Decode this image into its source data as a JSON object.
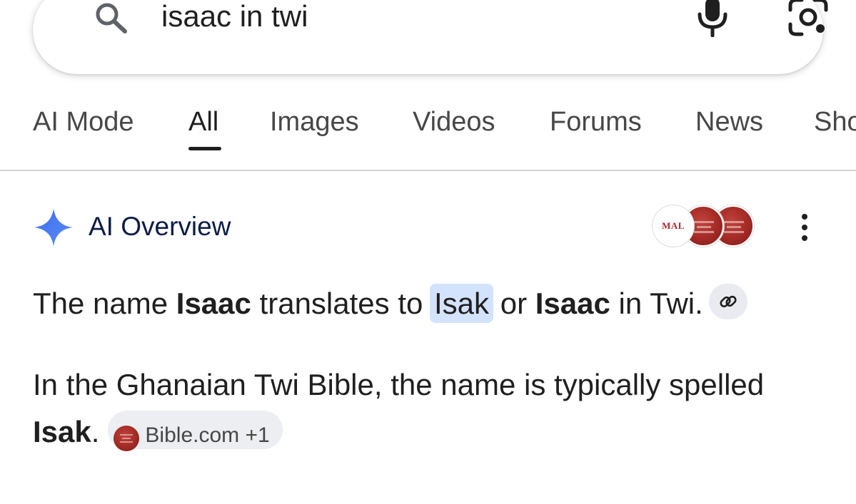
{
  "search": {
    "query": "isaac in twi"
  },
  "tabs": [
    {
      "label": "AI Mode",
      "active": false
    },
    {
      "label": "All",
      "active": true
    },
    {
      "label": "Images",
      "active": false
    },
    {
      "label": "Videos",
      "active": false
    },
    {
      "label": "Forums",
      "active": false
    },
    {
      "label": "News",
      "active": false
    },
    {
      "label": "Sho",
      "active": false
    }
  ],
  "ai_overview": {
    "title": "AI Overview",
    "source_logos": [
      "MAL"
    ],
    "paragraph1": {
      "t1": "The name ",
      "b1": "Isaac",
      "t2": " translates to ",
      "hl": "Isak",
      "t3": " or ",
      "b2": "Isaac",
      "t4": " in Twi."
    },
    "paragraph2": {
      "line1": "In the Ghanaian Twi Bible, the name is typically spelled",
      "bold": "Isak",
      "end": ".",
      "source_chip": "Bible.com +1"
    }
  },
  "colors": {
    "accent_blue": "#4285f4",
    "highlight": "#d3e3fd",
    "title_navy": "#0b1c46",
    "bible_red": "#9f2823"
  },
  "icons": [
    "search-icon",
    "mic-icon",
    "google-lens-icon",
    "ai-sparkle-icon",
    "more-vert-icon",
    "link-icon"
  ]
}
